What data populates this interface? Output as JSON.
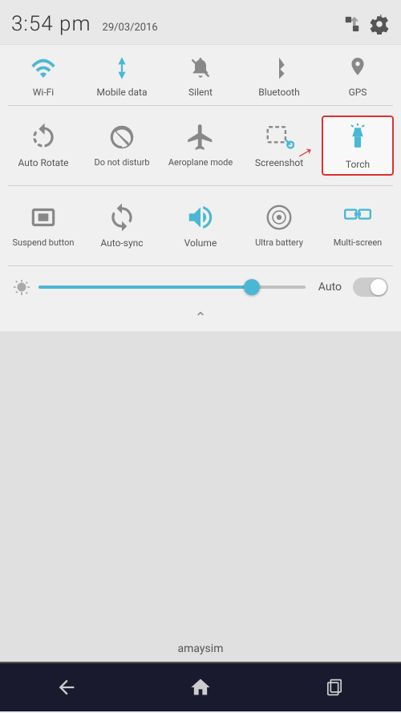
{
  "statusBar": {
    "time": "3:54 pm",
    "date": "29/03/2016"
  },
  "row1": {
    "items": [
      {
        "id": "wifi",
        "label": "Wi-Fi",
        "icon": "wifi"
      },
      {
        "id": "mobile-data",
        "label": "Mobile data",
        "icon": "mobile-data"
      },
      {
        "id": "silent",
        "label": "Silent",
        "icon": "silent"
      },
      {
        "id": "bluetooth",
        "label": "Bluetooth",
        "icon": "bluetooth"
      },
      {
        "id": "gps",
        "label": "GPS",
        "icon": "gps"
      }
    ]
  },
  "row2": {
    "items": [
      {
        "id": "auto-rotate",
        "label": "Auto Rotate",
        "icon": "auto-rotate"
      },
      {
        "id": "do-not-disturb",
        "label": "Do not disturb",
        "icon": "do-not-disturb"
      },
      {
        "id": "aeroplane-mode",
        "label": "Aeroplane mode",
        "icon": "aeroplane"
      },
      {
        "id": "screenshot",
        "label": "Screenshot",
        "icon": "screenshot"
      },
      {
        "id": "torch",
        "label": "Torch",
        "icon": "torch",
        "highlighted": true
      }
    ]
  },
  "row3": {
    "items": [
      {
        "id": "suspend-button",
        "label": "Suspend button",
        "icon": "suspend"
      },
      {
        "id": "auto-sync",
        "label": "Auto-sync",
        "icon": "auto-sync"
      },
      {
        "id": "volume",
        "label": "Volume",
        "icon": "volume"
      },
      {
        "id": "ultra-battery",
        "label": "Ultra battery",
        "icon": "battery"
      },
      {
        "id": "multi-screen",
        "label": "Multi-screen",
        "icon": "multi-screen"
      }
    ]
  },
  "brightness": {
    "label": "Auto",
    "value": 80
  },
  "carrier": "amaysim",
  "nav": {
    "back": "←",
    "home": "⌂",
    "recent": "▣"
  }
}
